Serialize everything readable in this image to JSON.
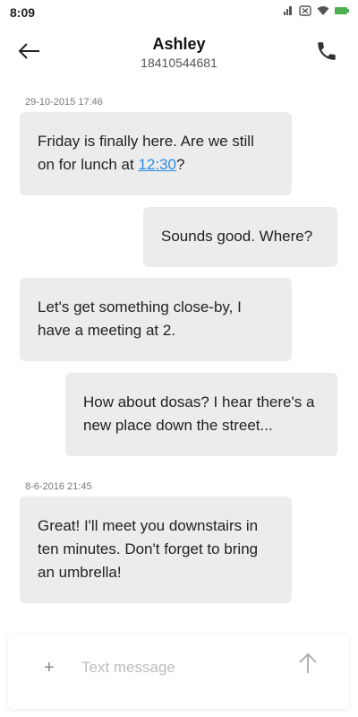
{
  "status_bar": {
    "time": "8:09",
    "icons": [
      "signal-icon",
      "sim-off-icon",
      "wifi-icon",
      "battery-icon"
    ],
    "battery_color": "#4caf50"
  },
  "header": {
    "contact_name": "Ashley",
    "contact_number": "18410544681",
    "back_icon": "arrow-left-icon",
    "call_icon": "phone-icon"
  },
  "conversation": {
    "timestamps": [
      "29-10-2015 17:46",
      "8-6-2016 21:45"
    ],
    "messages": [
      {
        "direction": "incoming",
        "text_line1": "Friday is finally here. Are we still",
        "text_line2_prefix": "on for lunch at ",
        "text_line2_link": "12:30",
        "text_line2_suffix": "?"
      },
      {
        "direction": "outgoing",
        "text": "Sounds good. Where?"
      },
      {
        "direction": "incoming",
        "text": "Let's get something close-by, I have a meeting at 2."
      },
      {
        "direction": "outgoing",
        "text": "How about dosas? I hear there's a new place down the street..."
      },
      {
        "direction": "incoming",
        "text": "Great! I'll meet you downstairs in ten minutes. Don't forget to bring an umbrella!"
      }
    ]
  },
  "composer": {
    "plus_label": "+",
    "placeholder": "Text message",
    "value": "",
    "send_icon": "arrow-up-icon"
  },
  "colors": {
    "bubble_bg": "#ececec",
    "link": "#2a8ce6"
  }
}
